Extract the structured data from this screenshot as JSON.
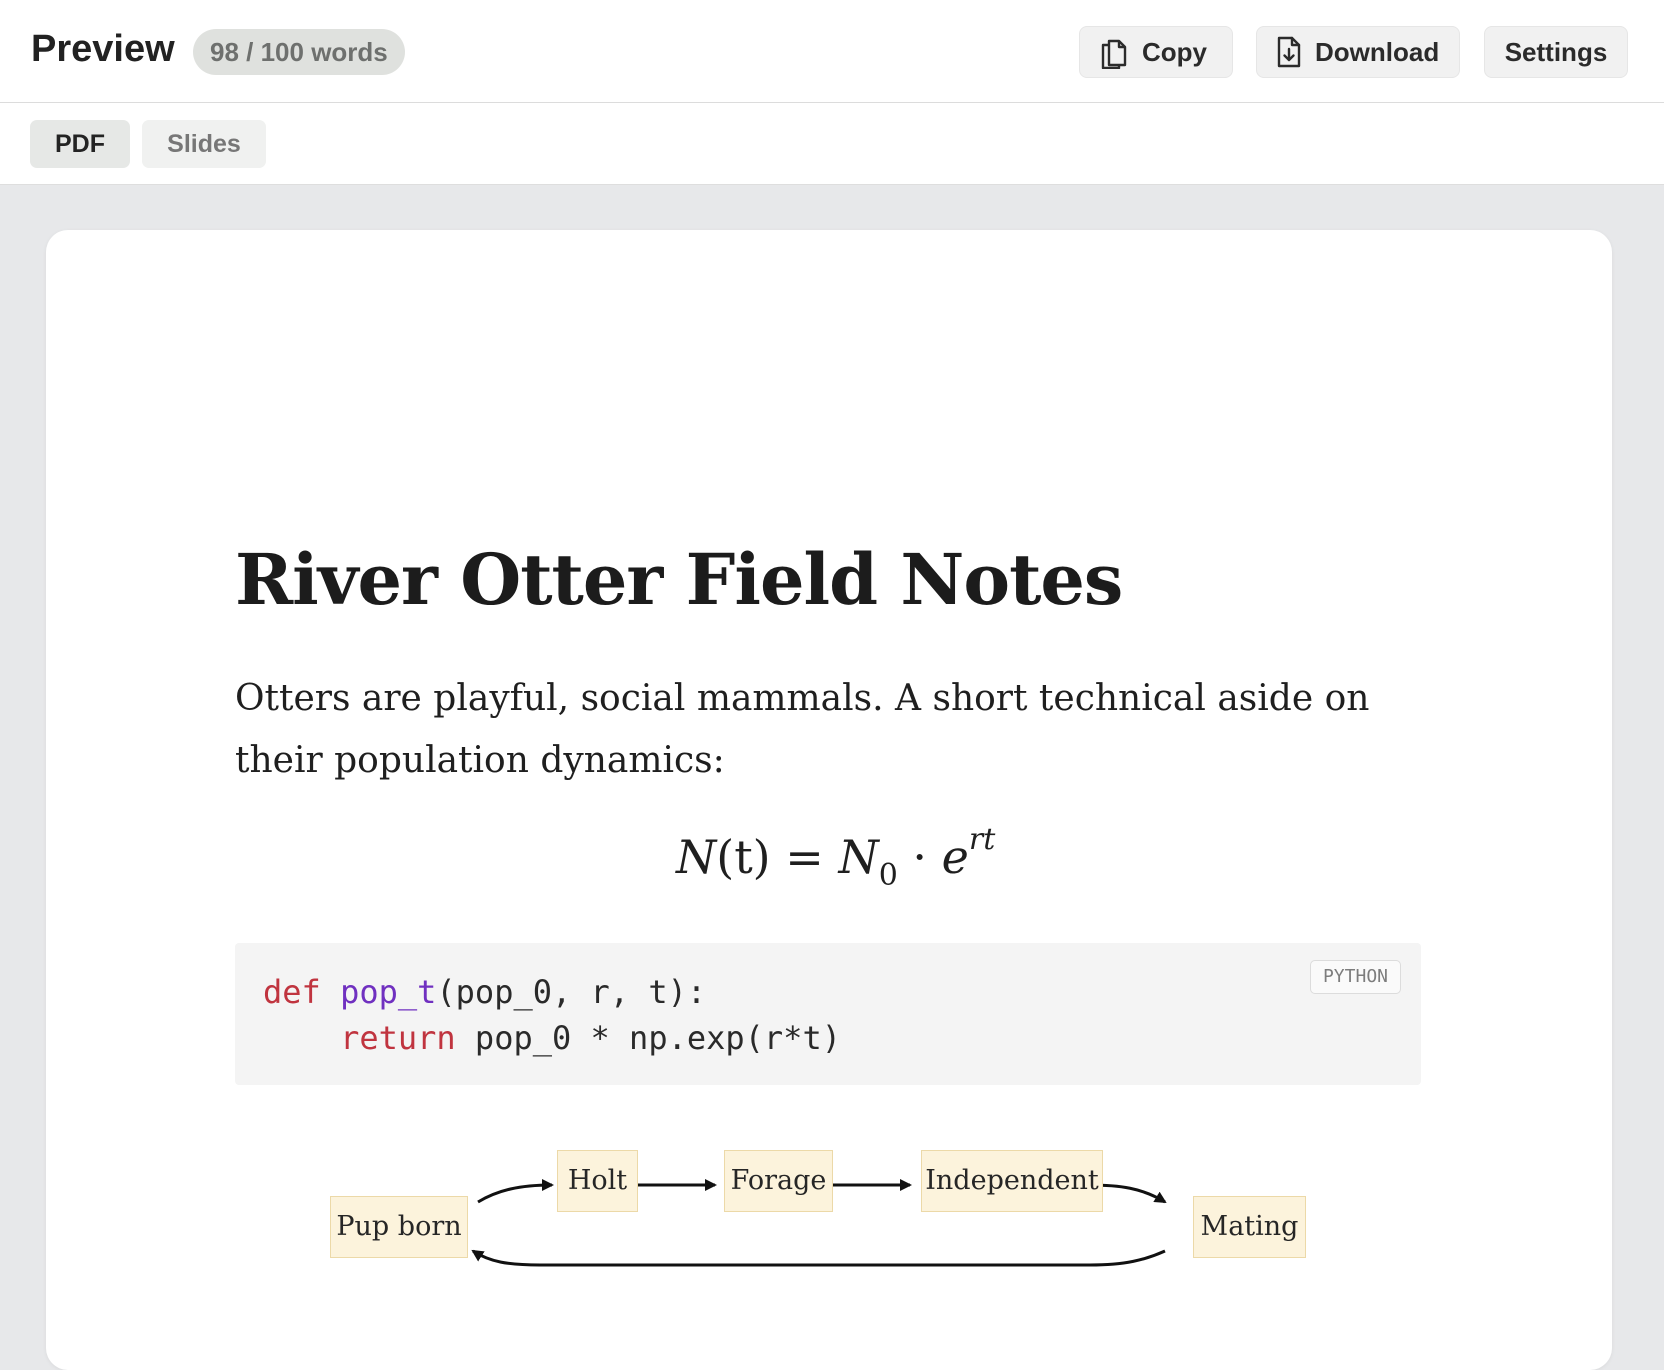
{
  "header": {
    "title": "Preview",
    "word_count": "98 / 100 words",
    "copy_label": "Copy",
    "download_label": "Download",
    "settings_label": "Settings"
  },
  "tabs": [
    {
      "label": "PDF",
      "active": true
    },
    {
      "label": "Slides",
      "active": false
    }
  ],
  "document": {
    "title": "River Otter Field Notes",
    "body": "Otters are playful, social mammals. A short technical aside on their population dynamics:",
    "formula": {
      "lhs_var": "N",
      "lhs_arg": "(t)",
      "equals": "=",
      "rhs_var": "N",
      "rhs_sub": "0",
      "dot": "·",
      "base": "e",
      "exponent": "rt"
    },
    "code": {
      "language": "PYTHON",
      "line1": {
        "kw": "def",
        "fn": "pop_t",
        "rest": "(pop_0, r, t):"
      },
      "line2": {
        "indent": "    ",
        "kw": "return",
        "rest": " pop_0 * np.exp(r*t)"
      }
    },
    "diagram": {
      "nodes": [
        "Pup born",
        "Holt",
        "Forage",
        "Independent",
        "Mating"
      ]
    }
  },
  "colors": {
    "keyword": "#c0343f",
    "function": "#7030c0",
    "node_fill": "#fcf3dc",
    "node_border": "#ecd9a8"
  }
}
